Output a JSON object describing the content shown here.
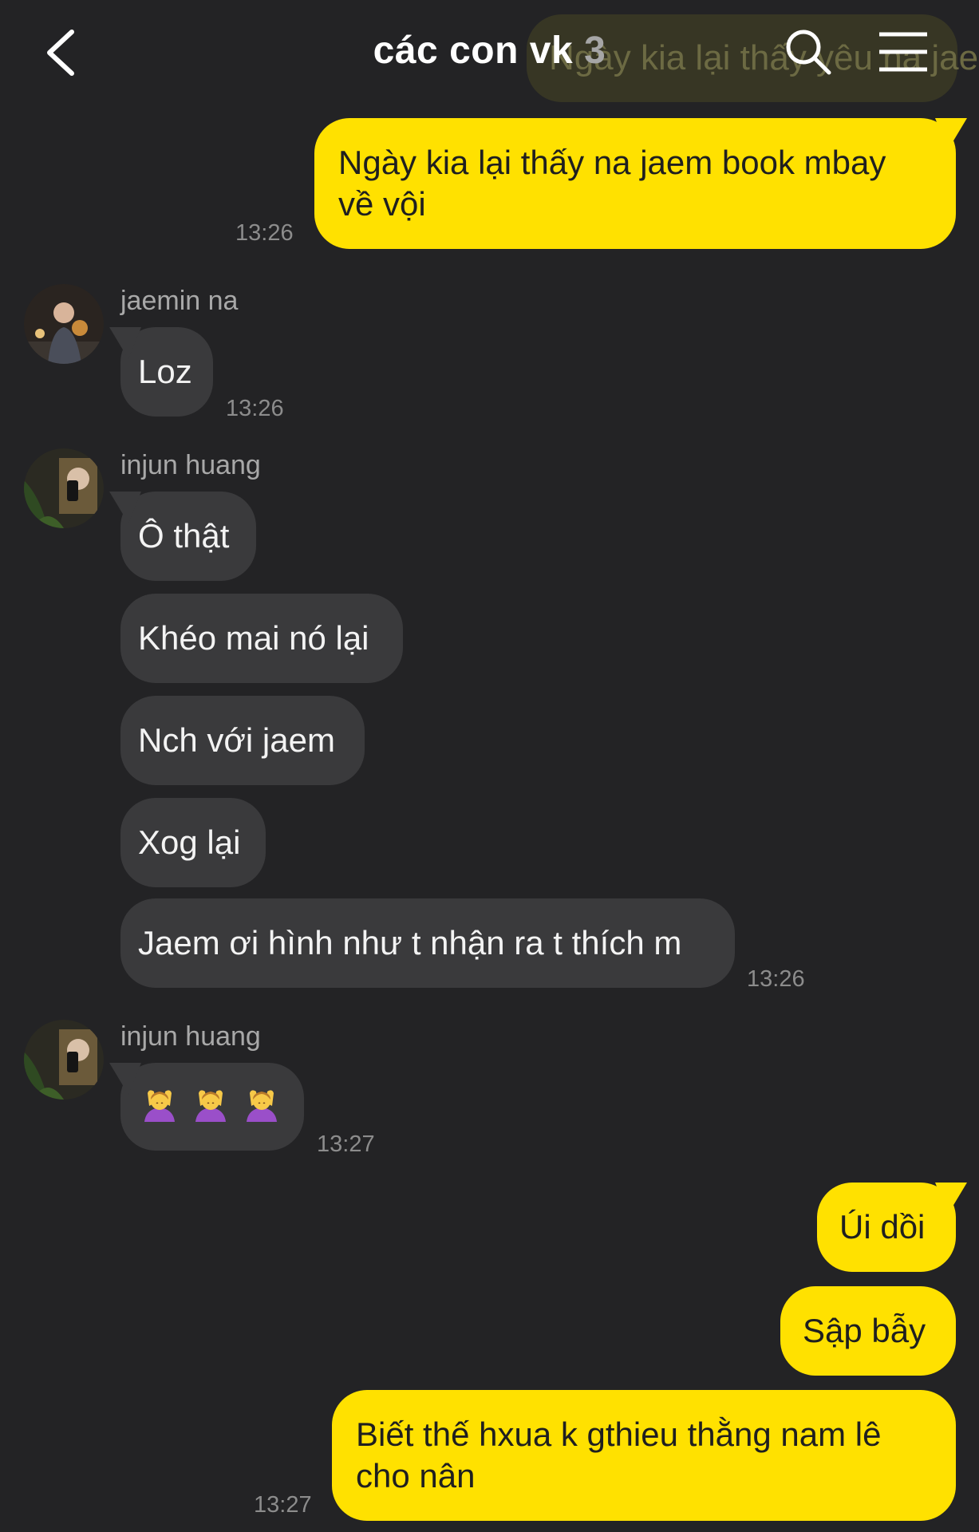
{
  "header": {
    "title": "các con vk",
    "member_count": "3",
    "back_icon": "chevron-left-icon",
    "search_icon": "search-icon",
    "menu_icon": "menu-icon",
    "ghost_preview": "Ngày kia lại thấy yêu na jaem"
  },
  "messages": {
    "m1": {
      "text_line1": "Ngày kia lại thấy na jaem book mbay",
      "text_line2": "về vội",
      "time": "13:26"
    },
    "g1": {
      "sender": "jaemin na",
      "text": "Loz",
      "time": "13:26"
    },
    "g2": {
      "sender": "injun huang",
      "texts": [
        "Ô thật",
        "Khéo mai nó lại",
        "Nch với jaem",
        "Xog lại",
        "Jaem ơi hình như t nhận ra t thích m"
      ],
      "time": "13:26"
    },
    "g3": {
      "sender": "injun huang",
      "emoji": "🙆‍♀️🙆‍♀️🙆‍♀️",
      "time": "13:27"
    },
    "m2": {
      "texts": [
        "Úi dồi",
        "Sập bẫy"
      ],
      "text3_line1": "Biết thế hxua k gthieu thằng nam lê",
      "text3_line2": "cho nân",
      "time": "13:27"
    }
  },
  "colors": {
    "background": "#232325",
    "my_bubble": "#ffe100",
    "their_bubble": "#3a3a3c"
  }
}
